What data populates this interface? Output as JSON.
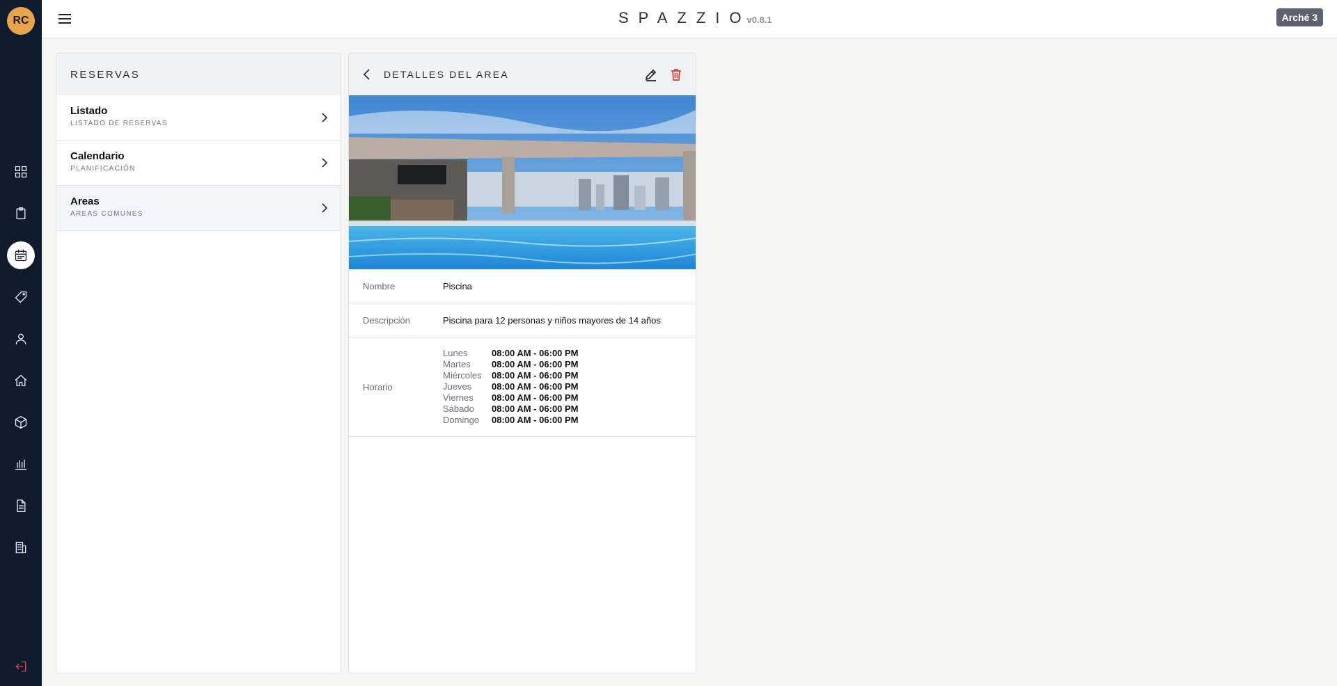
{
  "user": {
    "initials": "RC"
  },
  "app": {
    "logo": "SPAZZIO",
    "version": "v0.8.1",
    "workspace": "Arché 3"
  },
  "colors": {
    "rail": "#0f1c2d",
    "avatar": "#e7a44a",
    "danger": "#d23a33",
    "active_row": "#f2f5fb"
  },
  "rail_icons": [
    "dashboard-icon",
    "clipboard-icon",
    "calendar-icon",
    "tag-icon",
    "user-icon",
    "home-icon",
    "box-icon",
    "bar-chart-icon",
    "document-icon",
    "building-icon",
    "logout-icon"
  ],
  "reservas": {
    "title": "RESERVAS",
    "items": [
      {
        "label": "Listado",
        "sub": "LISTADO DE RESERVAS"
      },
      {
        "label": "Calendario",
        "sub": "PLANIFICACIÓN"
      },
      {
        "label": "Areas",
        "sub": "AREAS COMUNES"
      }
    ]
  },
  "detail": {
    "title": "DETALLES DEL AREA",
    "image_icon": "pool-photo",
    "name_label": "Nombre",
    "name_value": "Piscina",
    "desc_label": "Descripción",
    "desc_value": "Piscina para 12 personas y niños mayores de 14 años",
    "schedule_label": "Horario",
    "schedule": [
      {
        "day": "Lunes",
        "hours": "08:00 AM - 06:00 PM"
      },
      {
        "day": "Martes",
        "hours": "08:00 AM - 06:00 PM"
      },
      {
        "day": "Miércoles",
        "hours": "08:00 AM - 06:00 PM"
      },
      {
        "day": "Jueves",
        "hours": "08:00 AM - 06:00 PM"
      },
      {
        "day": "Viernes",
        "hours": "08:00 AM - 06:00 PM"
      },
      {
        "day": "Sábado",
        "hours": "08:00 AM - 06:00 PM"
      },
      {
        "day": "Domingo",
        "hours": "08:00 AM - 06:00 PM"
      }
    ]
  }
}
